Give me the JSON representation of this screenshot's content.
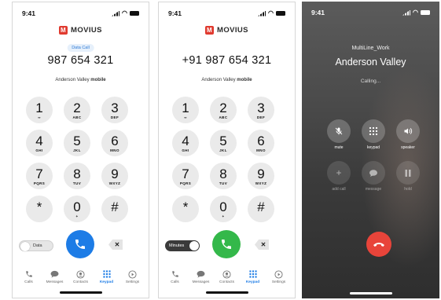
{
  "brand": "MOVIUS",
  "screens": [
    {
      "time": "9:41",
      "pill": "Data Call",
      "number": "987 654 321",
      "contact_name": "Anderson Valley",
      "contact_type": "mobile",
      "toggle_label": "Data",
      "toggle_state": "off",
      "call_color": "#1d7ce6"
    },
    {
      "time": "9:41",
      "number": "+91  987 654 321",
      "contact_name": "Anderson Valley",
      "contact_type": "mobile",
      "toggle_label": "Minutes",
      "toggle_state": "on",
      "call_color": "#34b84a"
    },
    {
      "time": "9:41",
      "line_name": "MultiLine_Work",
      "callee": "Anderson Valley",
      "status": "Calling...",
      "controls": [
        {
          "label": "mute",
          "icon": "mic-off-icon",
          "enabled": true
        },
        {
          "label": "keypad",
          "icon": "keypad-icon",
          "enabled": true
        },
        {
          "label": "speaker",
          "icon": "speaker-icon",
          "enabled": true
        },
        {
          "label": "add call",
          "icon": "plus-icon",
          "enabled": false
        },
        {
          "label": "message",
          "icon": "message-icon",
          "enabled": false
        },
        {
          "label": "hold",
          "icon": "pause-icon",
          "enabled": false
        }
      ],
      "end_color": "#e8443a"
    }
  ],
  "keys": [
    {
      "digit": "1",
      "letters": "∞"
    },
    {
      "digit": "2",
      "letters": "ABC"
    },
    {
      "digit": "3",
      "letters": "DEF"
    },
    {
      "digit": "4",
      "letters": "GHI"
    },
    {
      "digit": "5",
      "letters": "JKL"
    },
    {
      "digit": "6",
      "letters": "MNO"
    },
    {
      "digit": "7",
      "letters": "PQRS"
    },
    {
      "digit": "8",
      "letters": "TUV"
    },
    {
      "digit": "9",
      "letters": "WXYZ"
    },
    {
      "digit": "*",
      "letters": ""
    },
    {
      "digit": "0",
      "letters": "+"
    },
    {
      "digit": "#",
      "letters": ""
    }
  ],
  "tabs": [
    {
      "label": "Calls",
      "icon": "phone-icon"
    },
    {
      "label": "Messages",
      "icon": "chat-icon"
    },
    {
      "label": "Contacts",
      "icon": "contacts-icon"
    },
    {
      "label": "Keypad",
      "icon": "keypad-icon",
      "active": true
    },
    {
      "label": "Settings",
      "icon": "settings-icon"
    }
  ],
  "colors": {
    "accent": "#1d7ce6",
    "brand_red": "#e03a2f",
    "end_call": "#e8443a",
    "call_green": "#34b84a"
  }
}
